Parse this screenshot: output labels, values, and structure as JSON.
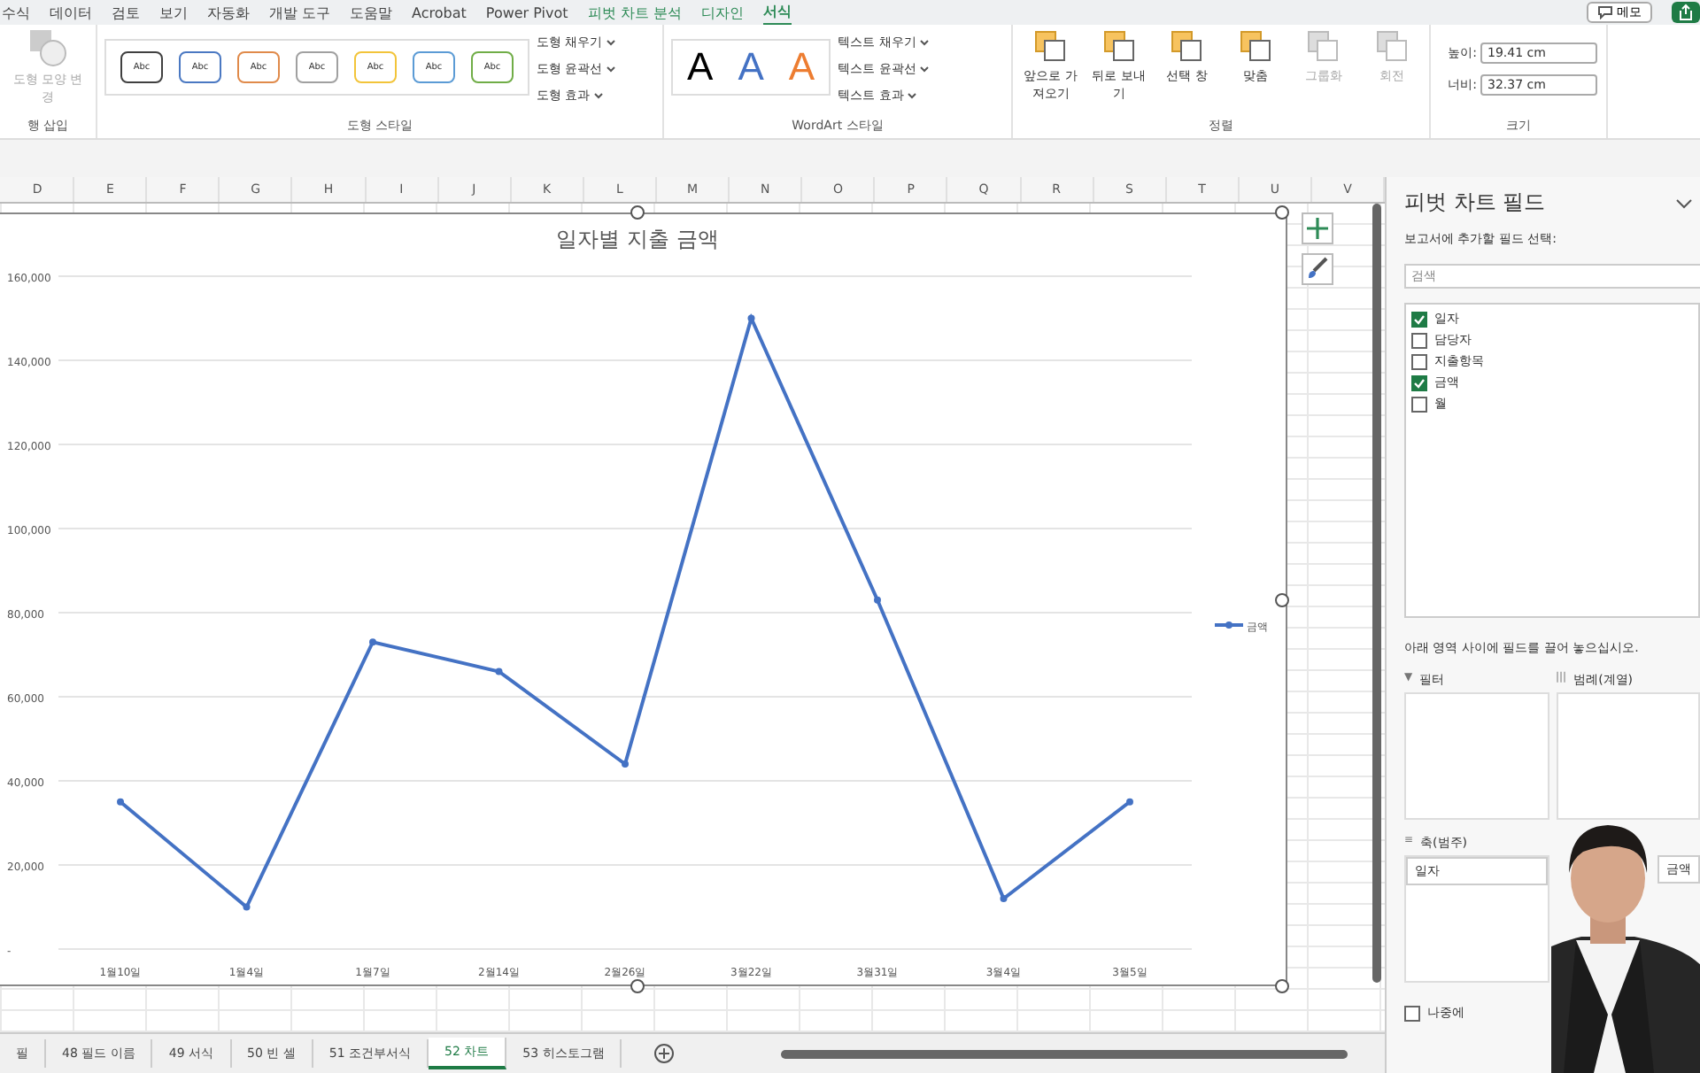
{
  "ribbon_tabs": [
    {
      "label": "수식",
      "selected": false,
      "contextual": false
    },
    {
      "label": "데이터",
      "selected": false,
      "contextual": false
    },
    {
      "label": "검토",
      "selected": false,
      "contextual": false
    },
    {
      "label": "보기",
      "selected": false,
      "contextual": false
    },
    {
      "label": "자동화",
      "selected": false,
      "contextual": false
    },
    {
      "label": "개발 도구",
      "selected": false,
      "contextual": false
    },
    {
      "label": "도움말",
      "selected": false,
      "contextual": false
    },
    {
      "label": "Acrobat",
      "selected": false,
      "contextual": false
    },
    {
      "label": "Power Pivot",
      "selected": false,
      "contextual": false
    },
    {
      "label": "피벗 차트 분석",
      "selected": false,
      "contextual": true
    },
    {
      "label": "디자인",
      "selected": false,
      "contextual": true
    },
    {
      "label": "서식",
      "selected": true,
      "contextual": true
    }
  ],
  "top_right": {
    "memo": "메모"
  },
  "ribbon": {
    "insert_group": {
      "label": "행 삽입",
      "command": {
        "label": "도형 모양 변경",
        "disabled": true
      }
    },
    "shape_styles": {
      "label": "도형 스타일",
      "swatches": [
        {
          "label": "Abc",
          "color": "#404040"
        },
        {
          "label": "Abc",
          "color": "#4a78c2"
        },
        {
          "label": "Abc",
          "color": "#e08a4a"
        },
        {
          "label": "Abc",
          "color": "#a0a0a0"
        },
        {
          "label": "Abc",
          "color": "#f2c43a"
        },
        {
          "label": "Abc",
          "color": "#5b9bd5"
        },
        {
          "label": "Abc",
          "color": "#70ad47"
        }
      ],
      "commands": [
        "도형 채우기",
        "도형 윤곽선",
        "도형 효과"
      ]
    },
    "wordart": {
      "label": "WordArt 스타일",
      "letters": [
        {
          "label": "A",
          "color": "#000000"
        },
        {
          "label": "A",
          "color": "#4472c4"
        },
        {
          "label": "A",
          "color": "#ed7d31"
        }
      ],
      "commands": [
        "텍스트 채우기",
        "텍스트 윤곽선",
        "텍스트 효과"
      ]
    },
    "arrange": {
      "label": "정렬",
      "commands": [
        {
          "label": "앞으로 가져오기",
          "disabled": false
        },
        {
          "label": "뒤로 보내기",
          "disabled": false
        },
        {
          "label": "선택 창",
          "disabled": false
        },
        {
          "label": "맞춤",
          "disabled": false
        },
        {
          "label": "그룹화",
          "disabled": true
        },
        {
          "label": "회전",
          "disabled": true
        }
      ]
    },
    "size": {
      "label": "크기",
      "height_label": "높이:",
      "height": "19.41 cm",
      "width_label": "너비:",
      "width": "32.37 cm"
    }
  },
  "columns": [
    "D",
    "E",
    "F",
    "G",
    "H",
    "I",
    "J",
    "K",
    "L",
    "M",
    "N",
    "O",
    "P",
    "Q",
    "R",
    "S",
    "T",
    "U",
    "V"
  ],
  "chart": {
    "chart_data": {
      "type": "line",
      "title": "일자별 지출 금액",
      "categories": [
        "1월10일",
        "1월4일",
        "1월7일",
        "2월14일",
        "2월26일",
        "3월22일",
        "3월31일",
        "3월4일",
        "3월5일"
      ],
      "grid": true,
      "series": [
        {
          "name": "금액",
          "color": "#4472c4",
          "marker": "circle",
          "values": [
            35000,
            10000,
            73000,
            66000,
            44000,
            150000,
            83000,
            12000,
            35000
          ]
        }
      ],
      "ylim": [
        0,
        160000
      ],
      "yticks": [
        {
          "value": 0,
          "label": "-"
        },
        {
          "value": 20000,
          "label": "20,000"
        },
        {
          "value": 40000,
          "label": "40,000"
        },
        {
          "value": 60000,
          "label": "60,000"
        },
        {
          "value": 80000,
          "label": "80,000"
        },
        {
          "value": 100000,
          "label": "100,000"
        },
        {
          "value": 120000,
          "label": "120,000"
        },
        {
          "value": 140000,
          "label": "140,000"
        },
        {
          "value": 160000,
          "label": "160,000"
        }
      ]
    }
  },
  "sheet_tabs": [
    {
      "label": "필",
      "selected": false
    },
    {
      "label": "48 필드 이름",
      "selected": false
    },
    {
      "label": "49 서식",
      "selected": false
    },
    {
      "label": "50 빈 셀",
      "selected": false
    },
    {
      "label": "51 조건부서식",
      "selected": false
    },
    {
      "label": "52 차트",
      "selected": true
    },
    {
      "label": "53 히스토그램",
      "selected": false
    }
  ],
  "pivot_pane": {
    "title": "피벗 차트 필드",
    "prompt": "보고서에 추가할 필드 선택:",
    "search": {
      "placeholder": "검색"
    },
    "fields": [
      {
        "label": "일자",
        "checked": true
      },
      {
        "label": "담당자",
        "checked": false
      },
      {
        "label": "지출항목",
        "checked": false
      },
      {
        "label": "금액",
        "checked": true
      },
      {
        "label": "월",
        "checked": false
      }
    ],
    "drag_hint": "아래 영역 사이에 필드를 끌어 놓으십시오.",
    "areas": [
      {
        "label": "필터",
        "kind": "filter",
        "icon": "▼"
      },
      {
        "label": "범례(계열)",
        "kind": "legend",
        "icon": "|||"
      },
      {
        "label": "축(범주)",
        "kind": "axis",
        "icon": "≡",
        "items": [
          "일자"
        ]
      },
      {
        "kind": "values",
        "items": [
          "금액"
        ]
      }
    ],
    "defer": {
      "label": "나중에",
      "checked": false
    }
  }
}
